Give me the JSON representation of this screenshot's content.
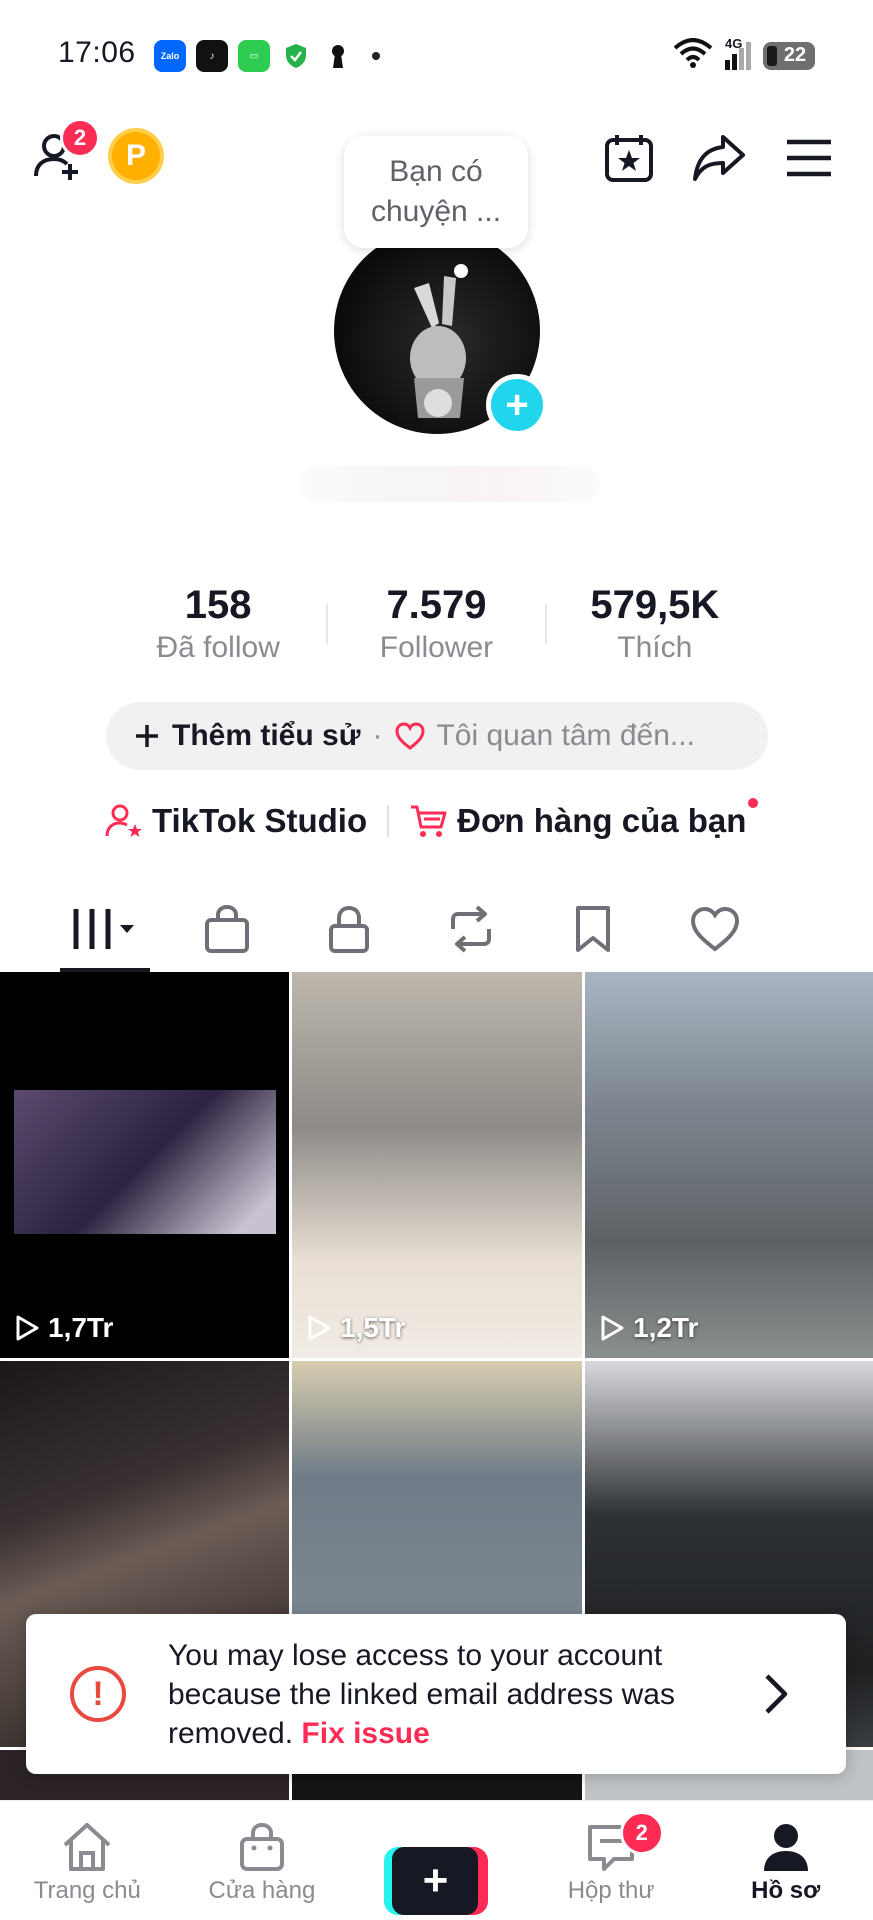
{
  "status_bar": {
    "time": "17:06",
    "apps": [
      "Zalo",
      "TikTok",
      "Messages",
      "Shield",
      "Keyhole"
    ],
    "network": "4G",
    "battery": "22"
  },
  "header": {
    "friends_badge": "2",
    "coin_label": "P"
  },
  "profile": {
    "bubble_text": "Bạn có chuyện ...",
    "add_avatar": "+"
  },
  "stats": [
    {
      "value": "158",
      "label": "Đã follow"
    },
    {
      "value": "7.579",
      "label": "Follower"
    },
    {
      "value": "579,5K",
      "label": "Thích"
    }
  ],
  "bio": {
    "add_label": "Thêm tiểu sử",
    "separator": "·",
    "interest_placeholder": "Tôi quan tâm đến..."
  },
  "links": {
    "studio": "TikTok Studio",
    "orders": "Đơn hàng của bạn"
  },
  "tabs": [
    "videos-grid",
    "shop",
    "private",
    "reposts",
    "favorites",
    "liked"
  ],
  "videos": [
    {
      "views": "1,7Tr"
    },
    {
      "views": "1,5Tr"
    },
    {
      "views": "1,2Tr"
    }
  ],
  "warning": {
    "message": "You may lose access to your account because the linked email address was removed.",
    "action": "Fix issue"
  },
  "nav": {
    "home": "Trang chủ",
    "shop": "Cửa hàng",
    "create": "+",
    "inbox": "Hộp thư",
    "inbox_badge": "2",
    "profile": "Hồ sơ"
  },
  "colors": {
    "accent": "#fe2c55",
    "cyan": "#25f4ee",
    "avatar_add": "#20d5ec",
    "coin": "#ffb000",
    "warning": "#e9493f"
  }
}
